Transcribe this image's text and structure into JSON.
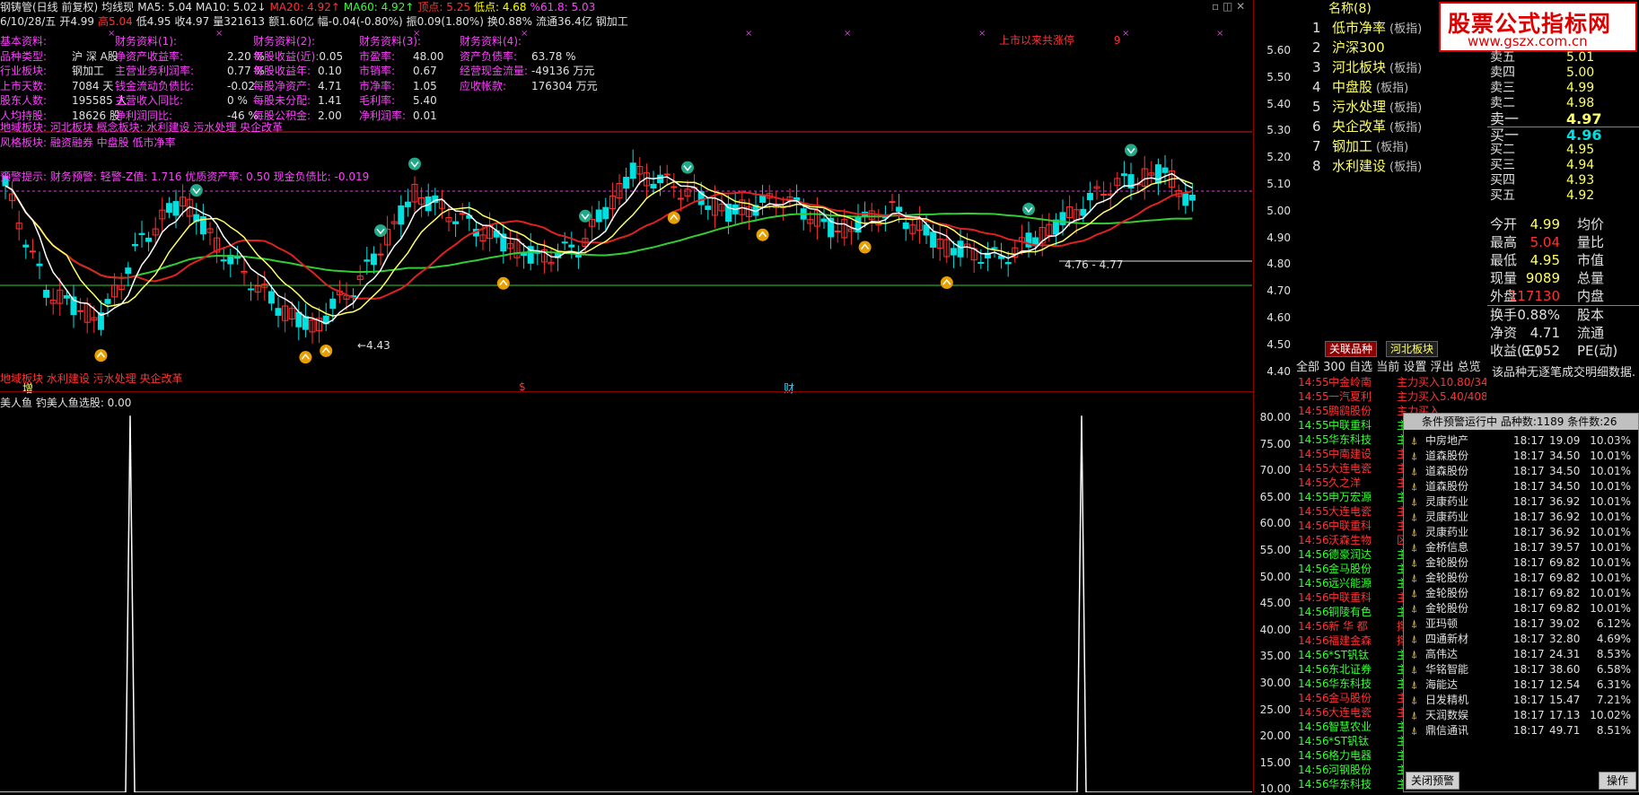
{
  "header": {
    "line1": [
      {
        "t": "钢铸管(日线 前复权)",
        "c": "white"
      },
      {
        "t": "均线现",
        "c": "white"
      },
      {
        "t": "MA5: 5.04",
        "c": "white"
      },
      {
        "t": "MA10: 5.02↓",
        "c": "white"
      },
      {
        "t": "MA20: 4.92↑",
        "c": "red"
      },
      {
        "t": "MA60: 4.92↑",
        "c": "green"
      },
      {
        "t": "顶点: 5.25",
        "c": "red"
      },
      {
        "t": "低点: 4.68",
        "c": "yellow"
      },
      {
        "t": "%61.8: 5.03",
        "c": "magenta"
      }
    ],
    "line2": [
      {
        "t": "6/10/28/五",
        "c": "white"
      },
      {
        "t": "开4.99",
        "c": "white"
      },
      {
        "t": "高5.04",
        "c": "red"
      },
      {
        "t": "低4.95",
        "c": "white"
      },
      {
        "t": "收4.97",
        "c": "white"
      },
      {
        "t": "量321613",
        "c": "white"
      },
      {
        "t": "额1.60亿",
        "c": "white"
      },
      {
        "t": "幅-0.04(-0.80%)",
        "c": "white"
      },
      {
        "t": "振0.09(1.80%)",
        "c": "white"
      },
      {
        "t": "换0.88%",
        "c": "white"
      },
      {
        "t": "流通36.4亿",
        "c": "white"
      },
      {
        "t": "钢加工",
        "c": "white"
      }
    ]
  },
  "finance": {
    "col1": {
      "title": "基本资料:",
      "rows": [
        [
          "品种类型:",
          "沪 深 A股"
        ],
        [
          "行业板块:",
          "钢加工"
        ],
        [
          "上市天数:",
          "7084   天"
        ],
        [
          "股东人数:",
          "195585 人"
        ],
        [
          "人均持股:",
          "18626  股"
        ]
      ]
    },
    "col2": {
      "title": "财务资料(1):",
      "rows": [
        [
          "净资产收益率:",
          "2.20 %"
        ],
        [
          "主营业务利润率:",
          "0.77 %"
        ],
        [
          "钱金流动负债比:",
          "-0.02"
        ],
        [
          "主营收入同比:",
          "0 %"
        ],
        [
          "净利润同比:",
          "-46 %"
        ]
      ]
    },
    "col3": {
      "title": "财务资料(2):",
      "rows": [
        [
          "每股收益(近):",
          "0.05"
        ],
        [
          "每股收益年:",
          "0.10"
        ],
        [
          "每股净资产:",
          "4.71"
        ],
        [
          "每股未分配:",
          "1.41"
        ],
        [
          "每股公积金:",
          "2.00"
        ]
      ]
    },
    "col4": {
      "title": "财务资料(3):",
      "rows": [
        [
          "市盈率:",
          "48.00"
        ],
        [
          "市销率:",
          "0.67"
        ],
        [
          "市净率:",
          "1.05"
        ],
        [
          "毛利率:",
          "5.40"
        ],
        [
          "净利润率:",
          "0.01"
        ]
      ]
    },
    "col5": {
      "title": "财务资料(4):",
      "rows": [
        [
          "资产负债率:",
          "63.78 %"
        ],
        [
          "经营现金流量:",
          "-49136 万元"
        ],
        [
          "应收帐款:",
          "176304 万元"
        ]
      ]
    },
    "concept1": "地域板块:   河北板块       概念板块: 水利建设 污水处理 央企改革",
    "concept2": "风格板块: 融资融券 中盘股 低市净率",
    "alert": "预警提示: 财务预警: 轻警-Z值: 1.716 优质资产率: 0.50 现金负债比: -0.019",
    "listed": "上市以来共涨停",
    "listed_num": "9"
  },
  "chart_annot": {
    "low_label": "←4.43",
    "range_label": "4.76 - 4.77",
    "foot_concept": "地域板块 水利建设 污水处理 央企改革",
    "foot_zeng": "增",
    "foot_s": "$",
    "foot_cai": "财"
  },
  "axis_main": [
    "5.60",
    "5.50",
    "5.40",
    "5.30",
    "5.20",
    "5.10",
    "5.00",
    "4.90",
    "4.80",
    "4.70",
    "4.60",
    "4.50",
    "4.40"
  ],
  "axis_sub": [
    "80.00",
    "75.00",
    "70.00",
    "65.00",
    "60.00",
    "55.00",
    "50.00",
    "45.00",
    "40.00",
    "35.00",
    "30.00",
    "25.00",
    "20.00",
    "15.00",
    "10.00"
  ],
  "sub_header": "美人鱼  钓美人鱼选股: 0.00",
  "rank": {
    "head": "名称(8)",
    "items": [
      {
        "n": "1",
        "t": "低市净率",
        "s": "(板指)"
      },
      {
        "n": "2",
        "t": "沪深300",
        "s": ""
      },
      {
        "n": "3",
        "t": "河北板块",
        "s": "(板指)"
      },
      {
        "n": "4",
        "t": "中盘股",
        "s": "(板指)"
      },
      {
        "n": "5",
        "t": "污水处理",
        "s": "(板指)"
      },
      {
        "n": "6",
        "t": "央企改革",
        "s": "(板指)"
      },
      {
        "n": "7",
        "t": "钢加工",
        "s": "(板指)"
      },
      {
        "n": "8",
        "t": "水利建设",
        "s": "(板指)"
      }
    ]
  },
  "logo": {
    "main": "股票公式指标网",
    "url": "www.gszx.com.cn"
  },
  "quote": {
    "rows": [
      {
        "l": "卖五",
        "p": "5.01",
        "v": ""
      },
      {
        "l": "卖四",
        "p": "5.00",
        "v": ""
      },
      {
        "l": "卖三",
        "p": "4.99",
        "v": ""
      },
      {
        "l": "卖二",
        "p": "4.98",
        "v": ""
      },
      {
        "l": "卖一",
        "p": "4.97",
        "v": ""
      },
      {
        "l": "买一",
        "p": "4.96",
        "v": ""
      },
      {
        "l": "买二",
        "p": "4.95",
        "v": ""
      },
      {
        "l": "买三",
        "p": "4.94",
        "v": ""
      },
      {
        "l": "买四",
        "p": "4.93",
        "v": ""
      },
      {
        "l": "买五",
        "p": "4.92",
        "v": ""
      }
    ]
  },
  "stats": [
    {
      "l": "今开",
      "v": "4.99",
      "vc": "#ffff66",
      "l2": "均价",
      "v2": ""
    },
    {
      "l": "最高",
      "v": "5.04",
      "vc": "#ff3333",
      "l2": "量比",
      "v2": ""
    },
    {
      "l": "最低",
      "v": "4.95",
      "vc": "#ffff66",
      "l2": "市值",
      "v2": ""
    },
    {
      "l": "现量",
      "v": "9089",
      "vc": "#ffff66",
      "l2": "总量",
      "v2": ""
    },
    {
      "l": "外盘",
      "v": "117130",
      "vc": "#ff3333",
      "l2": "内盘",
      "v2": ""
    },
    {
      "l": "换手",
      "v": "0.88%",
      "vc": "#e0e0e0",
      "l2": "股本",
      "v2": ""
    },
    {
      "l": "净资",
      "v": "4.71",
      "vc": "#e0e0e0",
      "l2": "流通",
      "v2": ""
    },
    {
      "l": "收益(三)",
      "v": "0.052",
      "vc": "#e0e0e0",
      "l2": "PE(动)",
      "v2": ""
    }
  ],
  "tabs": {
    "t1": "关联品种",
    "t2": "河北板块"
  },
  "filters": "全部  300  自选  当前  设置  浮出  总览",
  "no_detail": "该品种无逐笔成交明细数据.",
  "tape": [
    {
      "tm": "14:55",
      "nm": "中金岭南",
      "ty": "主力买入",
      "dt": "10.80/3423",
      "c": "#ff3333"
    },
    {
      "tm": "14:55",
      "nm": "一汽夏利",
      "ty": "主力买入",
      "dt": "5.40/4084",
      "c": "#ff3333"
    },
    {
      "tm": "14:55",
      "nm": "鹏鹞股份",
      "ty": "主力买入",
      "dt": "",
      "c": "#ff3333"
    },
    {
      "tm": "14:55",
      "nm": "中联重科",
      "ty": "主力",
      "dt": "",
      "c": "#33ff33"
    },
    {
      "tm": "14:55",
      "nm": "华东科技",
      "ty": "主力",
      "dt": "",
      "c": "#33ff33"
    },
    {
      "tm": "14:55",
      "nm": "中南建设",
      "ty": "主力",
      "dt": "",
      "c": "#ff3333"
    },
    {
      "tm": "14:55",
      "nm": "大连电瓷",
      "ty": "主力",
      "dt": "",
      "c": "#ff3333"
    },
    {
      "tm": "14:55",
      "nm": "久之洋",
      "ty": "主力",
      "dt": "",
      "c": "#ff3333"
    },
    {
      "tm": "14:55",
      "nm": "申万宏源",
      "ty": "主力",
      "dt": "",
      "c": "#33ff33"
    },
    {
      "tm": "14:55",
      "nm": "大连电瓷",
      "ty": "主力",
      "dt": "",
      "c": "#ff3333"
    },
    {
      "tm": "14:56",
      "nm": "中联重科",
      "ty": "主力",
      "dt": "",
      "c": "#ff3333"
    },
    {
      "tm": "14:56",
      "nm": "沃森生物",
      "ty": "区间",
      "dt": "",
      "c": "#ff3333"
    },
    {
      "tm": "14:56",
      "nm": "德豪润达",
      "ty": "主力",
      "dt": "",
      "c": "#33ff33"
    },
    {
      "tm": "14:56",
      "nm": "金马股份",
      "ty": "主力",
      "dt": "",
      "c": "#33ff33"
    },
    {
      "tm": "14:56",
      "nm": "远兴能源",
      "ty": "主力",
      "dt": "",
      "c": "#33ff33"
    },
    {
      "tm": "14:56",
      "nm": "中联重科",
      "ty": "主力",
      "dt": "",
      "c": "#ff3333"
    },
    {
      "tm": "14:56",
      "nm": "铜陵有色",
      "ty": "主力",
      "dt": "",
      "c": "#33ff33"
    },
    {
      "tm": "14:56",
      "nm": "新 华 都",
      "ty": "撑杆",
      "dt": "",
      "c": "#ff3333"
    },
    {
      "tm": "14:56",
      "nm": "福建金森",
      "ty": "撑杆",
      "dt": "",
      "c": "#ff3333"
    },
    {
      "tm": "14:56",
      "nm": "*ST钒钛",
      "ty": "主力",
      "dt": "",
      "c": "#33ff33"
    },
    {
      "tm": "14:56",
      "nm": "东北证券",
      "ty": "主力",
      "dt": "",
      "c": "#33ff33"
    },
    {
      "tm": "14:56",
      "nm": "华东科技",
      "ty": "主力",
      "dt": "",
      "c": "#33ff33"
    },
    {
      "tm": "14:56",
      "nm": "金马股份",
      "ty": "主力",
      "dt": "",
      "c": "#ff3333"
    },
    {
      "tm": "14:56",
      "nm": "大连电瓷",
      "ty": "主力",
      "dt": "",
      "c": "#ff3333"
    },
    {
      "tm": "14:56",
      "nm": "智慧农业",
      "ty": "主力",
      "dt": "",
      "c": "#33ff33"
    },
    {
      "tm": "14:56",
      "nm": "*ST钒钛",
      "ty": "主力",
      "dt": "",
      "c": "#33ff33"
    },
    {
      "tm": "14:56",
      "nm": "格力电器",
      "ty": "主力",
      "dt": "",
      "c": "#33ff33"
    },
    {
      "tm": "14:56",
      "nm": "河钢股份",
      "ty": "主力",
      "dt": "",
      "c": "#33ff33"
    },
    {
      "tm": "14:56",
      "nm": "华东科技",
      "ty": "主力卖出",
      "dt": "3.29/3002",
      "c": "#33ff33"
    }
  ],
  "popup": {
    "title": "条件预警运行中  品种数:1189  条件数:26",
    "rows": [
      {
        "nm": "中房地产",
        "tm": "18:17",
        "pc": "19.09",
        "cg": "10.03%"
      },
      {
        "nm": "道森股份",
        "tm": "18:17",
        "pc": "34.50",
        "cg": "10.01%"
      },
      {
        "nm": "道森股份",
        "tm": "18:17",
        "pc": "34.50",
        "cg": "10.01%"
      },
      {
        "nm": "道森股份",
        "tm": "18:17",
        "pc": "34.50",
        "cg": "10.01%"
      },
      {
        "nm": "灵康药业",
        "tm": "18:17",
        "pc": "36.92",
        "cg": "10.01%"
      },
      {
        "nm": "灵康药业",
        "tm": "18:17",
        "pc": "36.92",
        "cg": "10.01%"
      },
      {
        "nm": "灵康药业",
        "tm": "18:17",
        "pc": "36.92",
        "cg": "10.01%"
      },
      {
        "nm": "金桥信息",
        "tm": "18:17",
        "pc": "39.57",
        "cg": "10.01%"
      },
      {
        "nm": "金轮股份",
        "tm": "18:17",
        "pc": "69.82",
        "cg": "10.01%"
      },
      {
        "nm": "金轮股份",
        "tm": "18:17",
        "pc": "69.82",
        "cg": "10.01%"
      },
      {
        "nm": "金轮股份",
        "tm": "18:17",
        "pc": "69.82",
        "cg": "10.01%"
      },
      {
        "nm": "金轮股份",
        "tm": "18:17",
        "pc": "69.82",
        "cg": "10.01%"
      },
      {
        "nm": "亚玛顿",
        "tm": "18:17",
        "pc": "39.02",
        "cg": "6.12%"
      },
      {
        "nm": "四通新材",
        "tm": "18:17",
        "pc": "32.80",
        "cg": "4.69%"
      },
      {
        "nm": "高伟达",
        "tm": "18:17",
        "pc": "24.31",
        "cg": "8.53%"
      },
      {
        "nm": "华铭智能",
        "tm": "18:17",
        "pc": "38.60",
        "cg": "6.58%"
      },
      {
        "nm": "海能达",
        "tm": "18:17",
        "pc": "12.54",
        "cg": "6.31%"
      },
      {
        "nm": "日发精机",
        "tm": "18:17",
        "pc": "15.47",
        "cg": "7.21%"
      },
      {
        "nm": "天润数娱",
        "tm": "18:17",
        "pc": "17.13",
        "cg": "10.02%"
      },
      {
        "nm": "鼎信通讯",
        "tm": "18:17",
        "pc": "49.71",
        "cg": "8.51%"
      }
    ],
    "close_label": "关闭预警",
    "op_label": "操作"
  },
  "colors": {
    "up": "#ff3333",
    "down": "#00e0e0",
    "ma5": "#ffffff",
    "ma10": "#ffff66",
    "ma20": "#dd2222",
    "ma60": "#33cc33"
  }
}
